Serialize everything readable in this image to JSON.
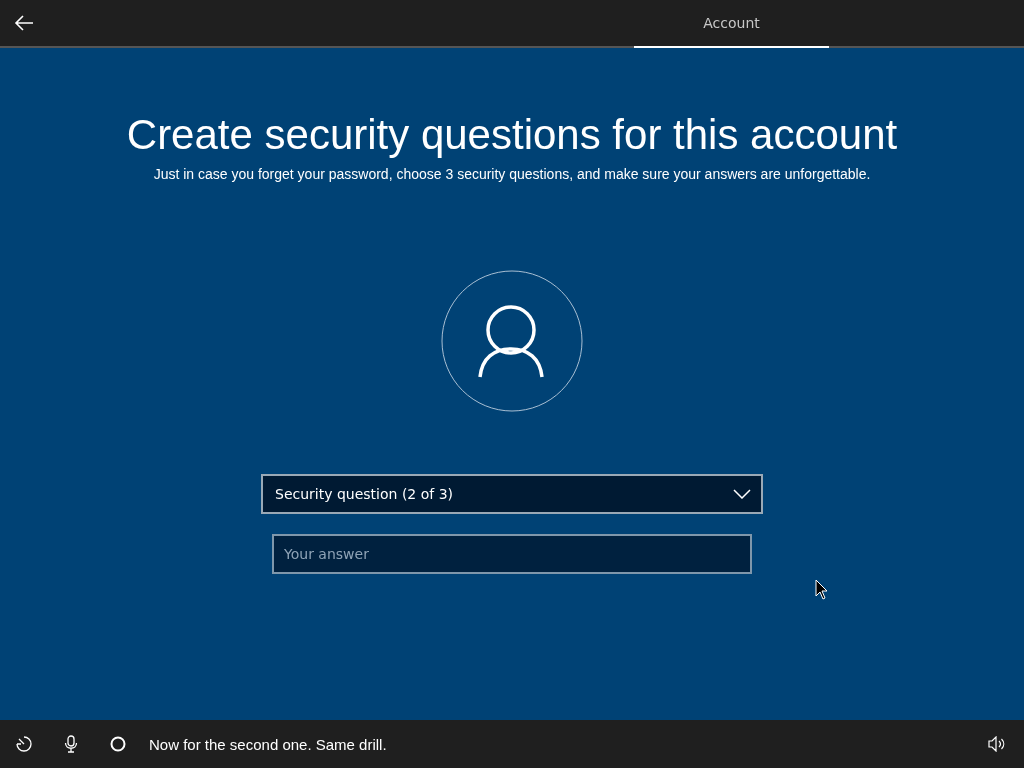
{
  "header": {
    "tabs": [
      {
        "label": "Account",
        "selected": true
      }
    ]
  },
  "title": "Create security questions for this account",
  "subtitle": "Just in case you forget your password, choose 3 security questions, and make sure your answers are unforgettable.",
  "question_dropdown": {
    "value": "Security question (2 of 3)"
  },
  "answer_field": {
    "placeholder": "Your answer"
  },
  "footer": {
    "caption": "Now for the second one. Same drill."
  }
}
